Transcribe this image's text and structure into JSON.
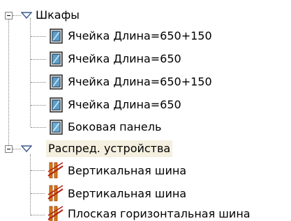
{
  "tree": {
    "groups": [
      {
        "label": "Шкафы",
        "icon": "filter-icon",
        "selected": false,
        "items": [
          {
            "label": "Ячейка Длина=650+150",
            "icon": "cabinet-cell-icon"
          },
          {
            "label": "Ячейка Длина=650",
            "icon": "cabinet-cell-icon"
          },
          {
            "label": "Ячейка Длина=650+150",
            "icon": "cabinet-cell-icon"
          },
          {
            "label": "Ячейка Длина=650",
            "icon": "cabinet-cell-icon"
          },
          {
            "label": "Боковая панель",
            "icon": "side-panel-icon"
          }
        ]
      },
      {
        "label": "Распред. устройства",
        "icon": "filter-icon",
        "selected": true,
        "items": [
          {
            "label": "Вертикальная шина",
            "icon": "busbar-icon"
          },
          {
            "label": "Вертикальная шина",
            "icon": "busbar-icon"
          },
          {
            "label": "Плоская горизонтальная шина",
            "icon": "busbar-icon"
          }
        ]
      }
    ],
    "colors": {
      "selection": "#f4efdf",
      "connector": "#808080",
      "cell_icon_border": "#2b2b2b",
      "cell_icon_fill": "#5a9fc9",
      "busbar_orange": "#e07a10",
      "busbar_red": "#b02010"
    }
  }
}
